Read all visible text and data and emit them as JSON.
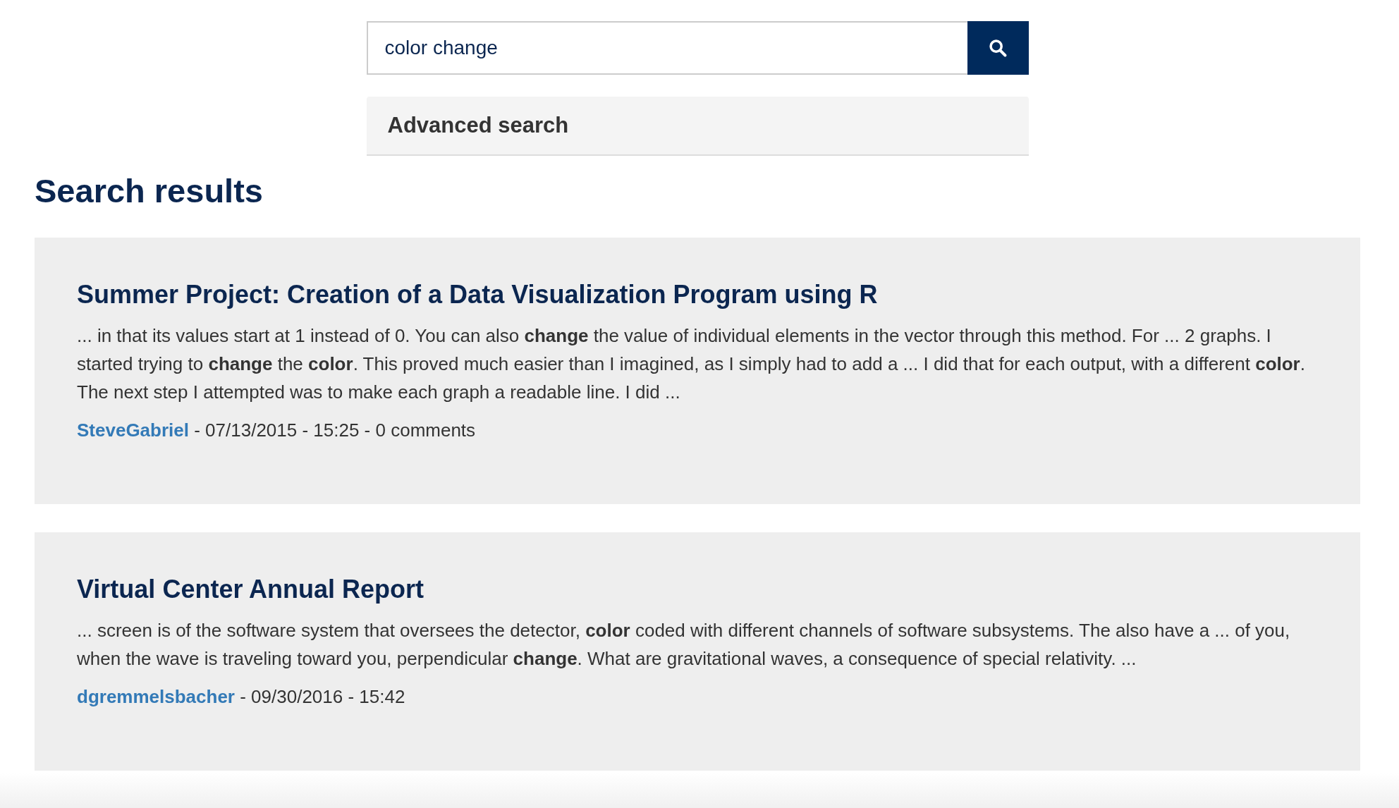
{
  "search": {
    "value": "color change"
  },
  "advanced_search": {
    "label": "Advanced search"
  },
  "heading": "Search results",
  "results": [
    {
      "title": "Summer Project: Creation of a Data Visualization Program using R",
      "snippet": "... in that its values start at 1 instead of 0. You can also **change** the value of individual elements in the vector through this method. For ... 2 graphs. I started trying to **change** the **color**. This proved much easier than I imagined, as I simply had to add a ...   I did that for each output, with a different **color**. The next step I attempted was to make each graph a readable line. I did ...",
      "author": "SteveGabriel",
      "details": " - 07/13/2015 - 15:25 - 0 comments"
    },
    {
      "title": "Virtual Center Annual Report",
      "snippet": "... screen is of the software system that oversees the detector, **color** coded with different channels of software subsystems.  The also have a ... of you, when the wave is traveling toward you, perpendicular **change**. What are gravitational waves, a consequence of special relativity. ...",
      "author": "dgremmelsbacher",
      "details": " - 09/30/2016 - 15:42"
    }
  ]
}
